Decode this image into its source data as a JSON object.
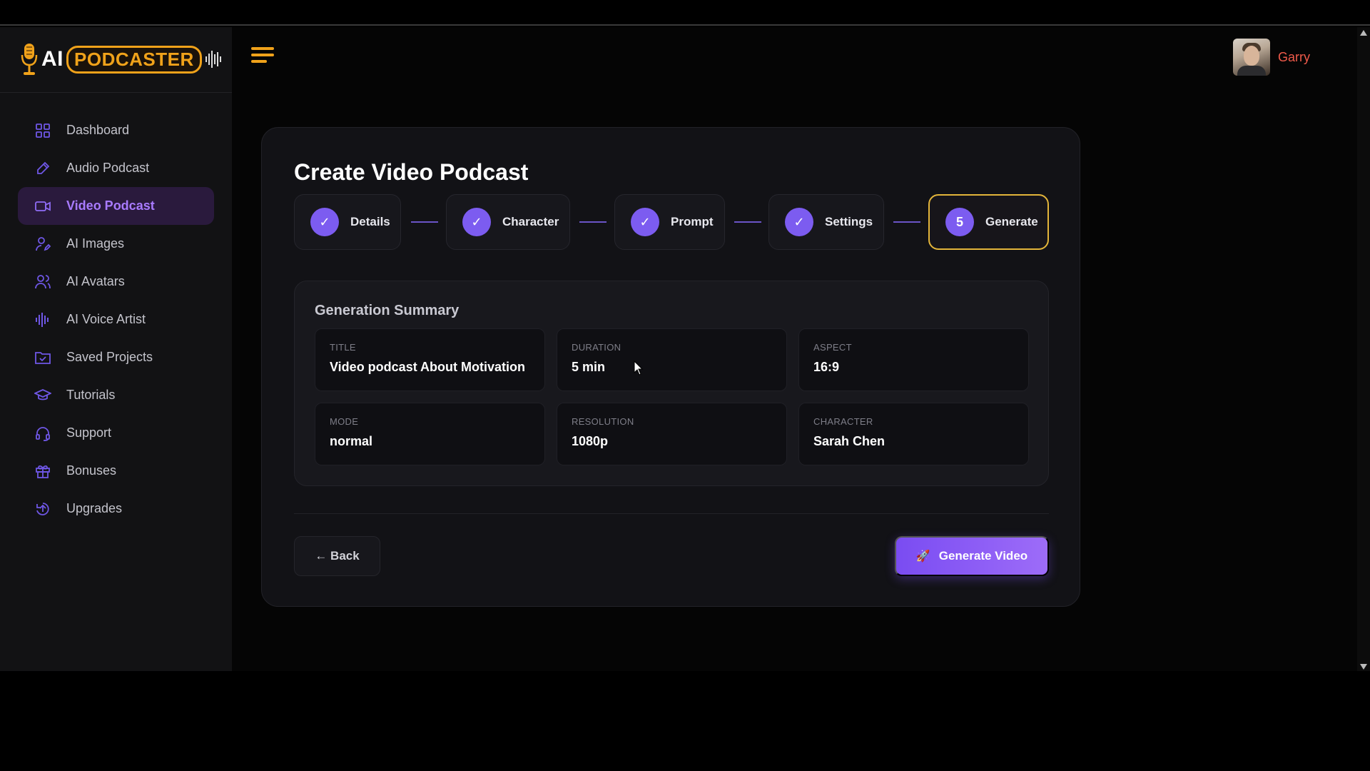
{
  "brand": {
    "logo_ai": "AI",
    "logo_word": "PODCASTER"
  },
  "colors": {
    "accent": "#7c5cf0",
    "gold": "#f0a21a",
    "user_name": "#ef5a4a",
    "active_nav_bg": "#2a1a3d"
  },
  "sidebar": {
    "items": [
      {
        "label": "Dashboard",
        "icon": "grid-icon"
      },
      {
        "label": "Audio Podcast",
        "icon": "pen-icon"
      },
      {
        "label": "Video Podcast",
        "icon": "video-icon",
        "active": true
      },
      {
        "label": "AI Images",
        "icon": "user-edit-icon"
      },
      {
        "label": "AI Avatars",
        "icon": "users-icon"
      },
      {
        "label": "AI Voice Artist",
        "icon": "soundwave-icon"
      },
      {
        "label": "Saved Projects",
        "icon": "folder-check-icon"
      },
      {
        "label": "Tutorials",
        "icon": "graduation-cap-icon"
      },
      {
        "label": "Support",
        "icon": "headset-icon"
      },
      {
        "label": "Bonuses",
        "icon": "gift-icon"
      },
      {
        "label": "Upgrades",
        "icon": "upgrade-icon"
      }
    ]
  },
  "header": {
    "user_name": "Garry"
  },
  "page": {
    "title": "Create Video Podcast",
    "steps": [
      {
        "label": "Details",
        "status": "done",
        "mark": "✓"
      },
      {
        "label": "Character",
        "status": "done",
        "mark": "✓"
      },
      {
        "label": "Prompt",
        "status": "done",
        "mark": "✓"
      },
      {
        "label": "Settings",
        "status": "done",
        "mark": "✓"
      },
      {
        "label": "Generate",
        "status": "current",
        "mark": "5"
      }
    ],
    "summary": {
      "title": "Generation Summary",
      "items": [
        {
          "key": "TITLE",
          "value": "Video podcast About Motivation"
        },
        {
          "key": "DURATION",
          "value": "5 min"
        },
        {
          "key": "ASPECT",
          "value": "16:9"
        },
        {
          "key": "MODE",
          "value": "normal"
        },
        {
          "key": "RESOLUTION",
          "value": "1080p"
        },
        {
          "key": "CHARACTER",
          "value": "Sarah Chen"
        }
      ]
    },
    "back_label": "← Back",
    "generate_label": "Generate Video",
    "generate_icon": "🚀"
  }
}
